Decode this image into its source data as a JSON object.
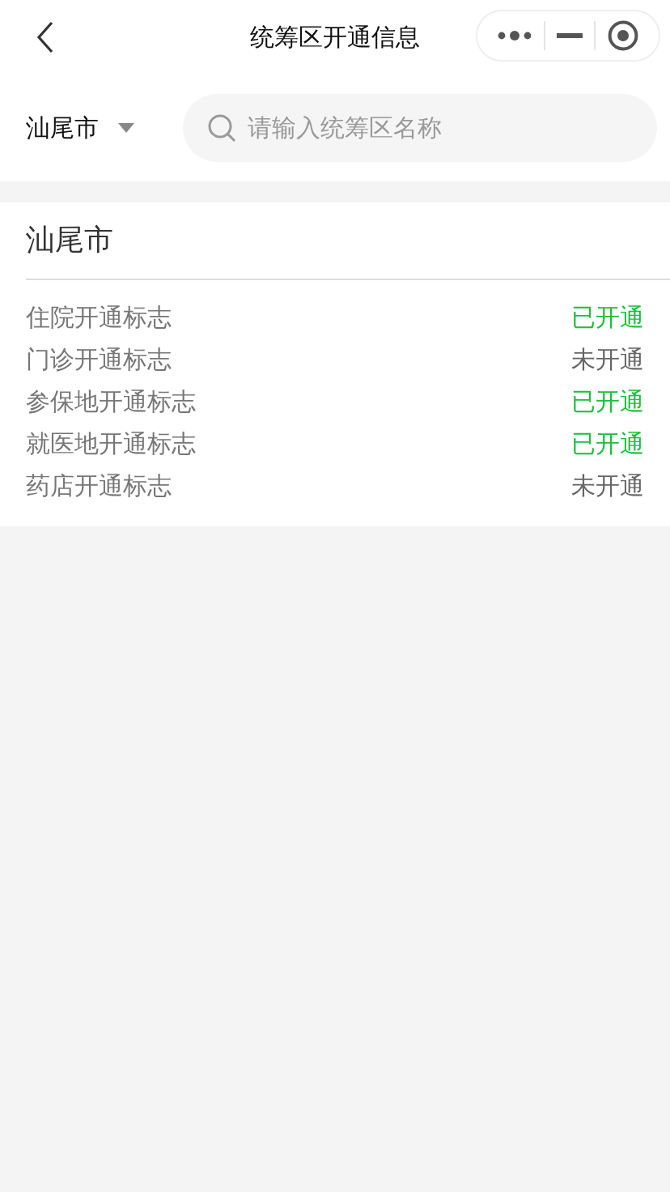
{
  "header": {
    "title": "统筹区开通信息"
  },
  "filter": {
    "city": "汕尾市",
    "search_placeholder": "请输入统筹区名称"
  },
  "card": {
    "title": "汕尾市",
    "rows": [
      {
        "label": "住院开通标志",
        "status": "已开通",
        "open": true
      },
      {
        "label": "门诊开通标志",
        "status": "未开通",
        "open": false
      },
      {
        "label": "参保地开通标志",
        "status": "已开通",
        "open": true
      },
      {
        "label": "就医地开通标志",
        "status": "已开通",
        "open": true
      },
      {
        "label": "药店开通标志",
        "status": "未开通",
        "open": false
      }
    ]
  }
}
